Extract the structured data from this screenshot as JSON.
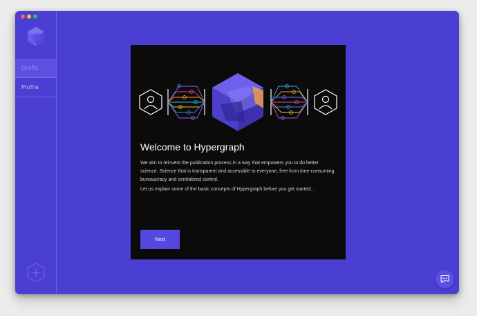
{
  "window": {
    "controls": [
      "close",
      "minimize",
      "maximize"
    ]
  },
  "sidebar": {
    "logo_icon": "hypergraph-logo-icon",
    "items": [
      {
        "label": "Drafts",
        "active": true
      },
      {
        "label": "Profile",
        "active": false
      }
    ],
    "add_icon": "hexagon-plus-icon"
  },
  "welcome": {
    "title": "Welcome to Hypergraph",
    "paragraph1": "We aim to reinvent the publication process in a way that empowers you to do better science. Science that is transparent and accessible to everyone, free from time-consuming bureaucracy and centralized control.",
    "paragraph2": "Let us explain some of the basic concepts of Hypergraph before you get started...",
    "next_label": "Next",
    "illustration_icons": [
      "user-hexagon-icon",
      "network-graph-icon",
      "hypergraph-cube-icon",
      "network-graph-icon",
      "user-hexagon-icon"
    ]
  },
  "chat": {
    "icon": "chat-bubble-icon"
  },
  "colors": {
    "background": "#4b3ed3",
    "card": "#0b0b0c",
    "accent": "#5548e0",
    "active_nav": "#5d50e0"
  }
}
